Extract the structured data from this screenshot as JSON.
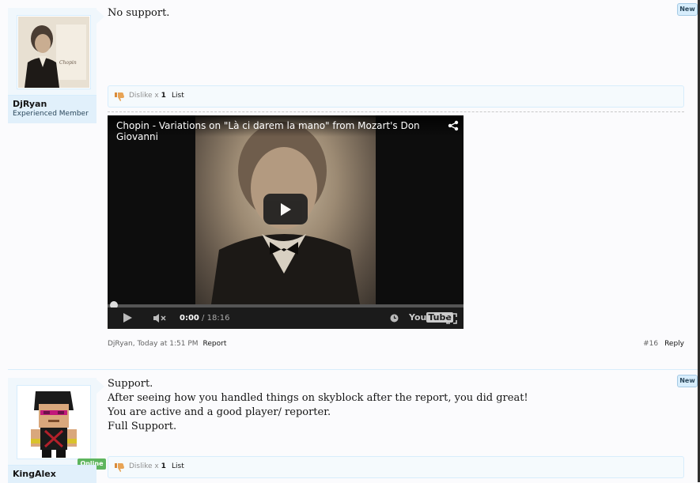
{
  "posts": [
    {
      "username": "DjRyan",
      "user_title": "Experienced Member",
      "badge": "New",
      "message_lines": [
        "No support."
      ],
      "reaction": {
        "label": "Dislike x",
        "count": "1",
        "list_label": "List"
      },
      "video": {
        "title": "Chopin - Variations on \"Là ci darem la mano\" from Mozart's Don Giovanni",
        "time_current": "0:00",
        "time_separator": " / ",
        "time_total": "18:16",
        "logo_text": "You",
        "logo_tube": "Tube",
        "played_fraction": 0
      },
      "meta": {
        "author_time": "DjRyan, Today at 1:51 PM",
        "report": "Report"
      },
      "post_number": "#16",
      "reply_label": "Reply"
    },
    {
      "username": "KingAlex",
      "status": "Online",
      "badge": "New",
      "message_lines": [
        "Support.",
        "After seeing how you handled things on skyblock after the report, you did great!",
        "You are active and a good player/ reporter.",
        "Full Support."
      ],
      "reaction": {
        "label": "Dislike x",
        "count": "1",
        "list_label": "List"
      }
    }
  ],
  "colors": {
    "accent": "#d7edfc",
    "user_panel": "#f0f7fc",
    "online": "#5eb55e"
  }
}
